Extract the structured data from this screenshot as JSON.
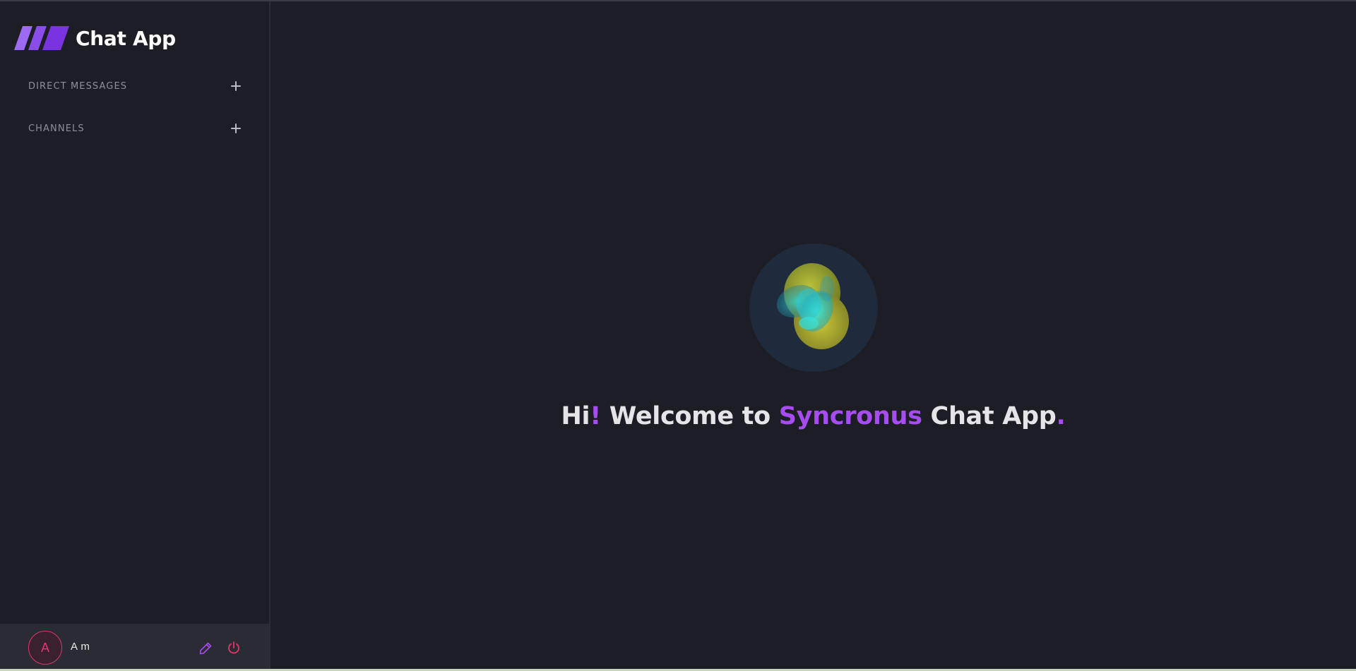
{
  "app": {
    "title": "Chat App"
  },
  "sidebar": {
    "sections": [
      {
        "label": "DIRECT MESSAGES",
        "action_icon": "plus-icon"
      },
      {
        "label": "CHANNELS",
        "action_icon": "plus-icon"
      }
    ]
  },
  "profile": {
    "avatar_initial": "A",
    "name": "A m",
    "edit_icon": "pencil-icon",
    "logout_icon": "power-icon"
  },
  "welcome": {
    "hi": "Hi",
    "exclaim": "!",
    "welcome_to": " Welcome to ",
    "brand": "Syncronus",
    "chat_app": " Chat App",
    "period": "."
  },
  "colors": {
    "background": "#1c1d25",
    "accent_purple": "#a64cf0",
    "logout_red": "#e2376e",
    "profile_bar": "#2a2b33"
  }
}
